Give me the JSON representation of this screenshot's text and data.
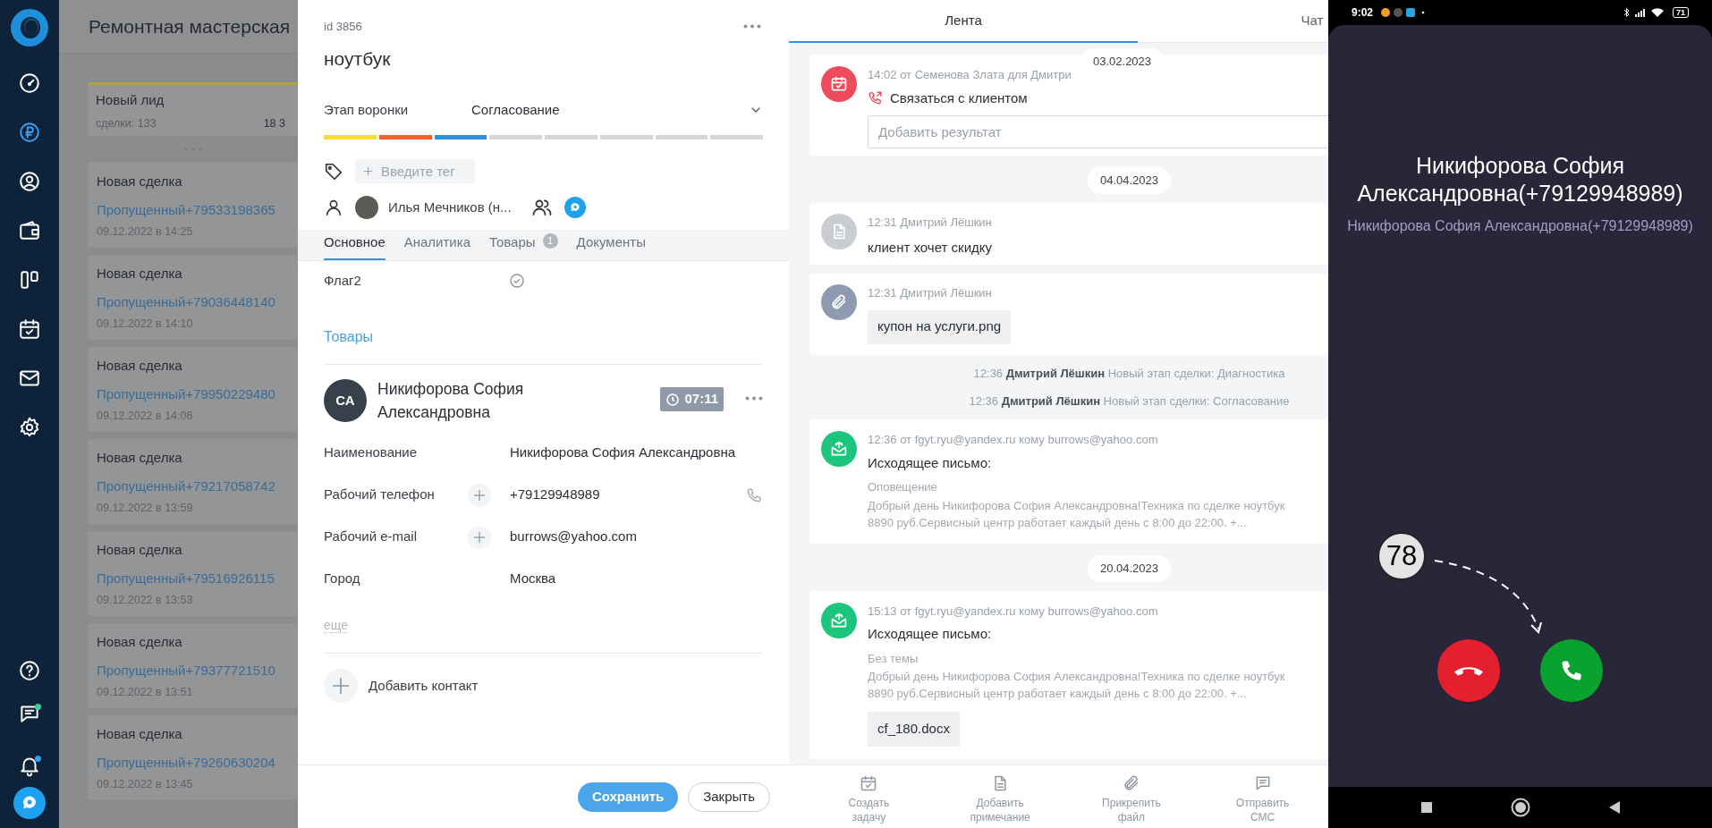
{
  "sidebar": {
    "top_items": [
      {
        "kind": "gauge",
        "selected": false
      },
      {
        "kind": "ruble",
        "selected": true
      },
      {
        "kind": "user",
        "selected": false
      },
      {
        "kind": "wallet",
        "selected": false
      },
      {
        "kind": "board",
        "selected": false
      },
      {
        "kind": "calendar",
        "selected": false
      },
      {
        "kind": "mail",
        "selected": false
      },
      {
        "kind": "gear",
        "selected": false
      }
    ],
    "bottom_items": [
      {
        "kind": "help"
      },
      {
        "kind": "chat",
        "color": "#3ecf8e"
      },
      {
        "kind": "bell",
        "color": "#3b9cf0"
      },
      {
        "kind": "messenger"
      }
    ]
  },
  "kanban": {
    "title": "Ремонтная мастерская",
    "column": {
      "title": "Новый лид",
      "count": "сделки: 133",
      "amount": "18 3"
    },
    "deals": [
      {
        "title": "Новая сделка",
        "link": "Пропущенный+79533198365",
        "date": "09.12.2022 в 14:25"
      },
      {
        "title": "Новая сделка",
        "link": "Пропущенный+79036448140",
        "date": "09.12.2022 в 14:10"
      },
      {
        "title": "Новая сделка",
        "link": "Пропущенный+79950229480",
        "date": "09.12.2022 в 14:06"
      },
      {
        "title": "Новая сделка",
        "link": "Пропущенный+79217058742",
        "date": "09.12.2022 в 13:59"
      },
      {
        "title": "Новая сделка",
        "link": "Пропущенный+79516926115",
        "date": "09.12.2022 в 13:53"
      },
      {
        "title": "Новая сделка",
        "link": "Пропущенный+79377721510",
        "date": "09.12.2022 в 13:51"
      },
      {
        "title": "Новая сделка",
        "link": "Пропущенный+79260630204",
        "date": "09.12.2022 в 13:45"
      }
    ]
  },
  "deal": {
    "id": "id 3856",
    "title": "ноутбук",
    "stage": {
      "label": "Этап воронки",
      "value": "Согласование"
    },
    "stages": [
      {
        "color": "#f5dc3b"
      },
      {
        "color": "#f0622d"
      },
      {
        "color": "#2f8fe0"
      },
      {
        "color": "#d3d5d8"
      },
      {
        "color": "#d3d5d8"
      },
      {
        "color": "#d3d5d8"
      },
      {
        "color": "#d3d5d8"
      },
      {
        "color": "#d3d5d8"
      }
    ],
    "tag_placeholder": "Введите тег",
    "responsible": "Илья Мечников (н...",
    "tabs": [
      {
        "label": "Основное",
        "selected": true
      },
      {
        "label": "Аналитика",
        "selected": false
      },
      {
        "label": "Товары",
        "selected": false,
        "badge": "1"
      },
      {
        "label": "Документы",
        "selected": false
      }
    ],
    "flags": [
      {
        "label": "Флаг2",
        "checked": true
      }
    ],
    "section_link": "Товары",
    "contact": {
      "initials": "СА",
      "name": "Никифорова София Александровна",
      "timer": "07:11",
      "fields": [
        {
          "kind": "text",
          "label": "Наименование",
          "value": "Никифорова София Александровна"
        },
        {
          "kind": "phone",
          "label": "Рабочий телефон",
          "value": "+79129948989"
        },
        {
          "kind": "email",
          "label": "Рабочий e-mail",
          "value": "burrows@yahoo.com"
        },
        {
          "kind": "text",
          "label": "Город",
          "value": "Москва"
        }
      ],
      "more": "еще"
    },
    "add_contact": "Добавить контакт",
    "buttons": [
      {
        "kind": "primary",
        "label": "Сохранить"
      },
      {
        "kind": "secondary",
        "label": "Закрыть"
      }
    ]
  },
  "feed": {
    "tabs": [
      {
        "label": "Лента",
        "selected": true
      },
      {
        "label": "Чат",
        "selected": false
      }
    ],
    "sticky_date": "03.02.2023",
    "items": [
      {
        "kind": "task",
        "meta": "14:02 от Семенова Злата для Дмитри",
        "title": "Связаться с клиентом",
        "placeholder": "Добавить результат"
      },
      {
        "kind": "date",
        "text": "04.04.2023"
      },
      {
        "kind": "note",
        "meta": "12:31 Дмитрий Лёшкин",
        "text": "клиент хочет скидку"
      },
      {
        "kind": "file",
        "meta": "12:31 Дмитрий Лёшкин",
        "file": "купон на услуги.png"
      },
      {
        "kind": "event",
        "time": "12:36",
        "author": "Дмитрий Лёшкин",
        "text": "Новый этап сделки: Диагностика"
      },
      {
        "kind": "event",
        "time": "12:36",
        "author": "Дмитрий Лёшкин",
        "text": "Новый этап сделки: Согласование"
      },
      {
        "kind": "email",
        "meta": "12:36 от fgyt.ryu@yandex.ru кому burrows@yahoo.com",
        "title": "Исходящее письмо:",
        "subject": "Оповещение",
        "body": [
          "Добрый день Никифорова София Александровна!Техника по сделке ноутбук",
          "8890 руб.Сервисный центр работает каждый день с 8:00 до 22:00. +..."
        ]
      },
      {
        "kind": "date",
        "text": "20.04.2023"
      },
      {
        "kind": "email",
        "meta": "15:13 от fgyt.ryu@yandex.ru кому burrows@yahoo.com",
        "title": "Исходящее письмо:",
        "subject": "Без темы",
        "body": [
          "Добрый день Никифорова София Александровна!Техника по сделке ноутбук",
          "8890 руб.Сервисный центр работает каждый день с 8:00 до 22:00. +..."
        ],
        "attachment": "cf_180.docx"
      }
    ],
    "actions": [
      {
        "kind": "task",
        "label": "Создать задачу"
      },
      {
        "kind": "note",
        "label": "Добавить примечание"
      },
      {
        "kind": "file",
        "label": "Прикрепить файл"
      },
      {
        "kind": "sms",
        "label": "Отправить СМС"
      }
    ]
  },
  "phone": {
    "status": {
      "time": "9:02",
      "battery": "71"
    },
    "caller": "Никифорова София Александровна(+79129948989)",
    "caller_sub": "Никифорова София Александровна(+79129948989)",
    "annotation": "78"
  }
}
